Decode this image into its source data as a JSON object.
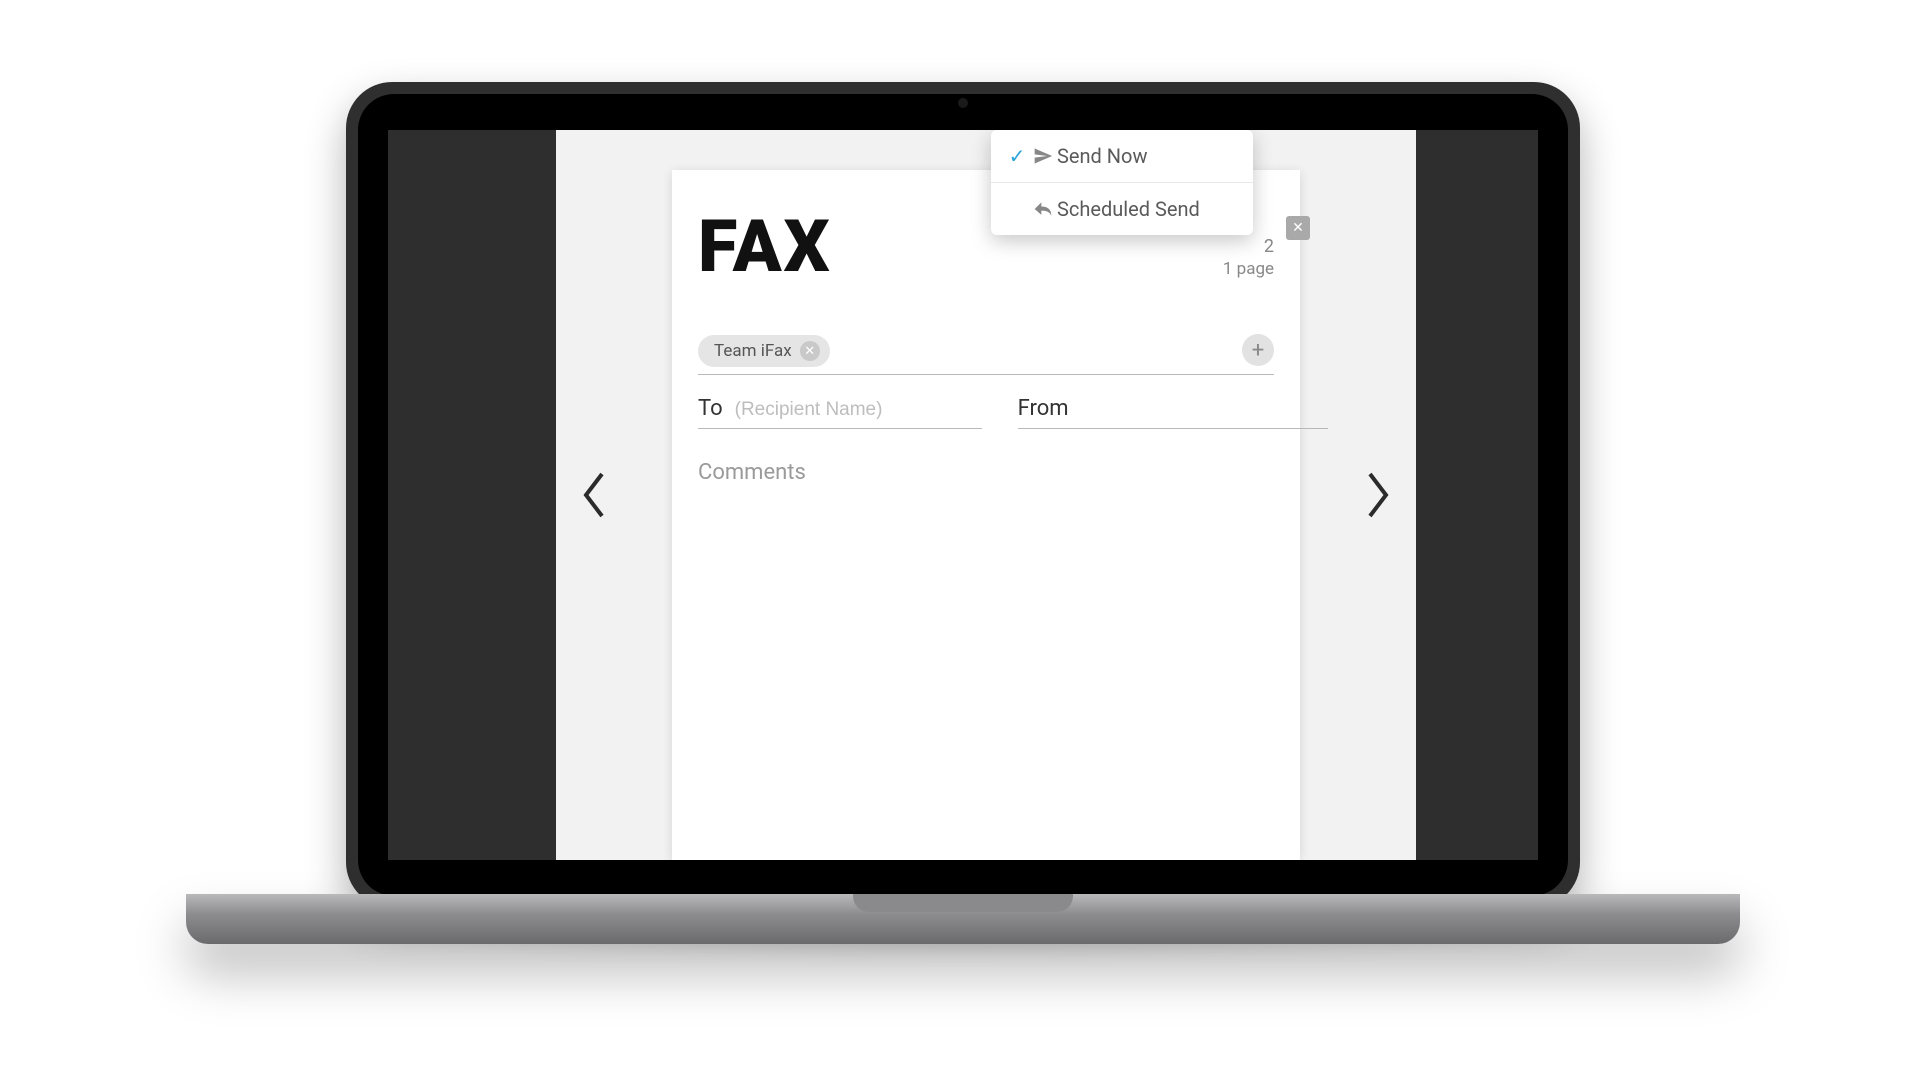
{
  "fax": {
    "title": "FAX",
    "date_partial": "2",
    "pages_label": "1 page",
    "recipient_chip": "Team iFax",
    "to_label": "To",
    "to_placeholder": "(Recipient Name)",
    "from_label": "From",
    "from_value": "",
    "comments_label": "Comments"
  },
  "send_menu": {
    "items": [
      {
        "label": "Send Now",
        "selected": true,
        "icon": "send"
      },
      {
        "label": "Scheduled Send",
        "selected": false,
        "icon": "clock-send"
      }
    ]
  }
}
